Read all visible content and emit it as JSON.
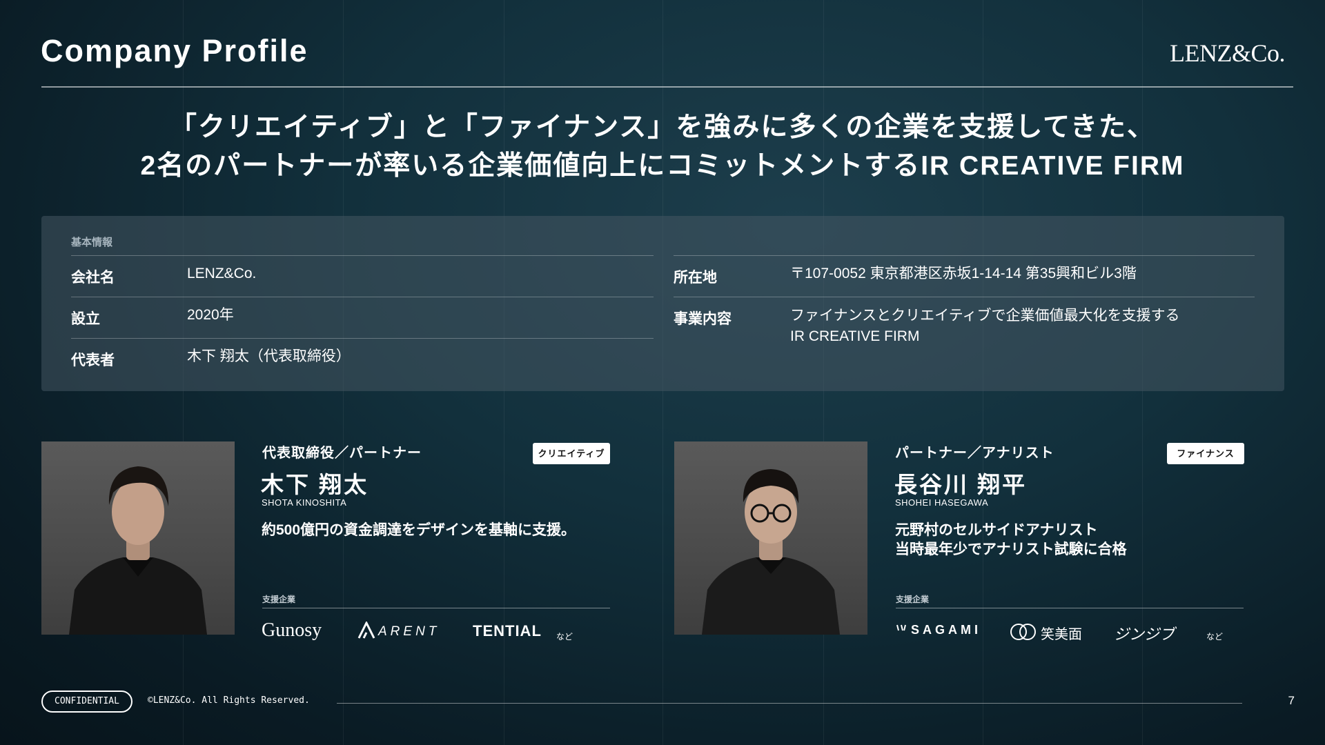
{
  "header": {
    "title": "Company Profile",
    "brand": "LENZ&Co."
  },
  "headline": {
    "line1": "「クリエイティブ」と「ファイナンス」を強みに多くの企業を支援してきた、",
    "line2": "2名のパートナーが率いる企業価値向上にコミットメントするIR CREATIVE FIRM"
  },
  "info": {
    "caption": "基本情報",
    "company_label": "会社名",
    "company_value": "LENZ&Co.",
    "founded_label": "設立",
    "founded_value": "2020年",
    "rep_label": "代表者",
    "rep_value": "木下 翔太（代表取締役）",
    "address_label": "所在地",
    "address_value": "〒107-0052 東京都港区赤坂1-14-14 第35興和ビル3階",
    "business_label": "事業内容",
    "business_line1": "ファイナンスとクリエイティブで企業価値最大化を支援する",
    "business_line2": "IR CREATIVE FIRM"
  },
  "partners": [
    {
      "role": "代表取締役／パートナー",
      "tag": "クリエイティブ",
      "name": "木下 翔太",
      "romaji": "SHOTA KINOSHITA",
      "desc1": "約500億円の資金調達をデザインを基軸に支援。",
      "desc2": "",
      "clients_caption": "支援企業",
      "clients": [
        "Gunosy",
        "ARENT",
        "TENTIAL"
      ],
      "etc": "など"
    },
    {
      "role": "パートナー／アナリスト",
      "tag": "ファイナンス",
      "name": "長谷川 翔平",
      "romaji": "SHOHEI HASEGAWA",
      "desc1": "元野村のセルサイドアナリスト",
      "desc2": "当時最年少でアナリスト試験に合格",
      "clients_caption": "支援企業",
      "clients": [
        "SAGAMI",
        "笑美面",
        "ジンジブ"
      ],
      "etc": "など"
    }
  ],
  "footer": {
    "confidential": "CONFIDENTIAL",
    "copyright": "©LENZ&Co. All Rights Reserved.",
    "page": "7"
  }
}
